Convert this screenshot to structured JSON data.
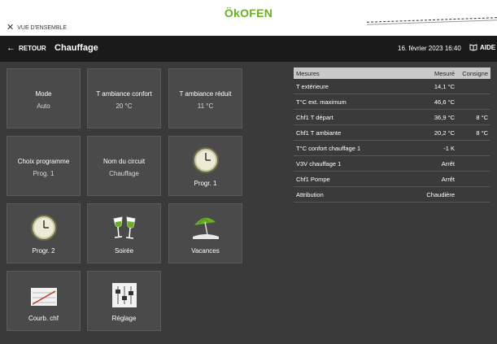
{
  "app": {
    "logo": "ÖkOFEN",
    "overview_label": "VUE D'ENSEMBLE"
  },
  "header": {
    "back_label": "RETOUR",
    "title": "Chauffage",
    "datetime": "16. février 2023 16:40",
    "help_label": "AIDE"
  },
  "tiles": [
    {
      "label": "Mode",
      "value": "Auto"
    },
    {
      "label": "T ambiance confort",
      "value": "20 °C"
    },
    {
      "label": "T ambiance réduit",
      "value": "11 °C"
    },
    {
      "label": "Choix programme",
      "value": "Prog. 1"
    },
    {
      "label": "Nom du circuit",
      "value": "Chauffage"
    },
    {
      "label": "Progr. 1",
      "icon": "clock-icon"
    },
    {
      "label": "Progr. 2",
      "icon": "clock-icon"
    },
    {
      "label": "Soirée",
      "icon": "wine-glasses-icon"
    },
    {
      "label": "Vacances",
      "icon": "beach-umbrella-icon"
    },
    {
      "label": "Courb. chf",
      "icon": "heating-curve-icon"
    },
    {
      "label": "Réglage",
      "icon": "sliders-icon"
    }
  ],
  "measures": {
    "headers": [
      "Mesures",
      "Mesuré",
      "Consigne"
    ],
    "rows": [
      [
        "T extérieure",
        "14,1 °C",
        ""
      ],
      [
        "T°C ext. maximum",
        "46,6 °C",
        ""
      ],
      [
        "Chf1 T départ",
        "36,9 °C",
        "8 °C"
      ],
      [
        "Chf1 T ambiante",
        "20,2 °C",
        "8 °C"
      ],
      [
        "T°C confort chauffage 1",
        "-1 K",
        ""
      ],
      [
        "V3V chauffage 1",
        "Arrêt",
        ""
      ],
      [
        "Chf1 Pompe",
        "Arrêt",
        ""
      ],
      [
        "Attribution",
        "Chaudière",
        ""
      ]
    ]
  },
  "colors": {
    "brand_green": "#6ab023",
    "tile_bg": "#4a4a4a",
    "header_bg": "#1a1a1a",
    "page_bg": "#3a3a3a"
  }
}
